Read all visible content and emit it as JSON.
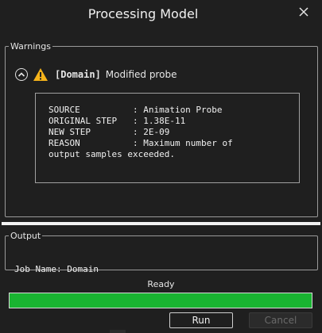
{
  "window": {
    "title": "Processing Model"
  },
  "warnings": {
    "legend": "Warnings",
    "items": [
      {
        "tag": "[Domain]",
        "message": "Modified probe",
        "details": [
          "SOURCE          : Animation Probe",
          "ORIGINAL STEP   : 1.38E-11",
          "NEW STEP        : 2E-09",
          "REASON          : Maximum number of",
          "output samples exceeded."
        ]
      }
    ]
  },
  "output": {
    "legend": "Output",
    "job_line": "Job Name: Domain"
  },
  "status": {
    "label": "Ready",
    "progress_percent": 100,
    "progress_color": "#19b431"
  },
  "buttons": {
    "run": "Run",
    "cancel": "Cancel"
  },
  "icons": {
    "close": "close-icon",
    "collapse": "chevron-up-icon",
    "warning": "warning-icon"
  }
}
